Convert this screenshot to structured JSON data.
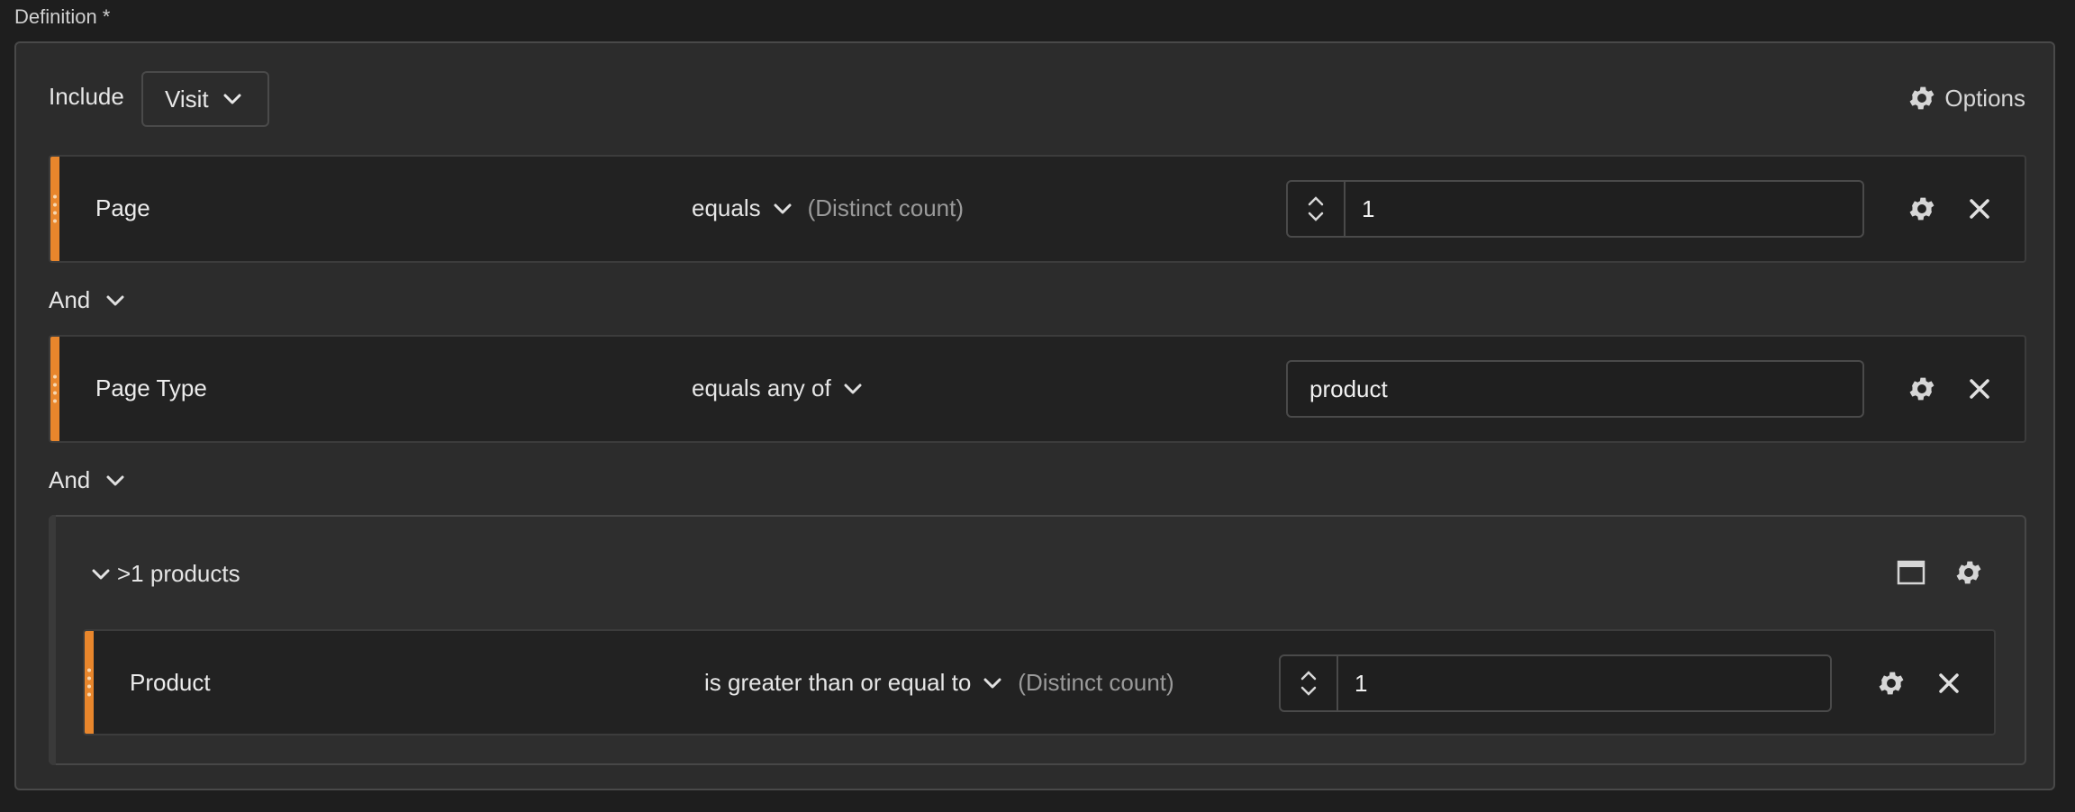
{
  "definition": {
    "label": "Definition",
    "required_mark": "*"
  },
  "header": {
    "include_label": "Include",
    "scope_value": "Visit",
    "options_label": "Options"
  },
  "rules": [
    {
      "dimension": "Page",
      "operator": "equals",
      "note": "(Distinct count)",
      "value": "1"
    },
    {
      "dimension": "Page Type",
      "operator": "equals any of",
      "value": "product"
    }
  ],
  "connectors": [
    "And",
    "And"
  ],
  "group": {
    "title": ">1 products",
    "rule": {
      "dimension": "Product",
      "operator": "is greater than or equal to",
      "note": "(Distinct count)",
      "value": "1"
    }
  },
  "colors": {
    "accent": "#e8862c",
    "background": "#1e1e1e",
    "panel": "#2c2c2c",
    "row": "#222222"
  },
  "icons": [
    "gear-icon",
    "close-icon",
    "chevron-down-icon",
    "stepper-up-icon",
    "stepper-down-icon",
    "window-icon"
  ]
}
